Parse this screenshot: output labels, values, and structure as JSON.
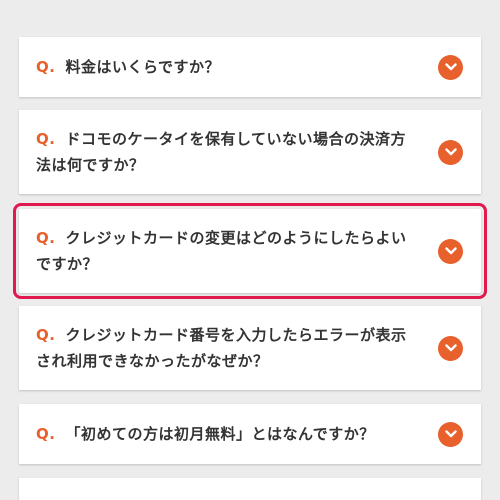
{
  "colors": {
    "accent": "#e8602c",
    "highlight_border": "#e0194f",
    "background": "#ececec",
    "card": "#ffffff",
    "text": "#333333"
  },
  "faq": {
    "q_prefix": "Q.",
    "items": [
      {
        "question": "料金はいくらですか？",
        "icon": "chevron-down-icon"
      },
      {
        "question": "ドコモのケータイを保有していない場合の決済方法は何ですか？",
        "icon": "chevron-down-icon"
      },
      {
        "question": "クレジットカードの変更はどのようにしたらよいですか？",
        "icon": "chevron-down-icon",
        "highlighted": true
      },
      {
        "question": "クレジットカード番号を入力したらエラーが表示され利用できなかったがなぜか？",
        "icon": "chevron-down-icon"
      },
      {
        "question": "「初めての方は初月無料」とはなんですか？",
        "icon": "chevron-down-icon"
      }
    ]
  }
}
